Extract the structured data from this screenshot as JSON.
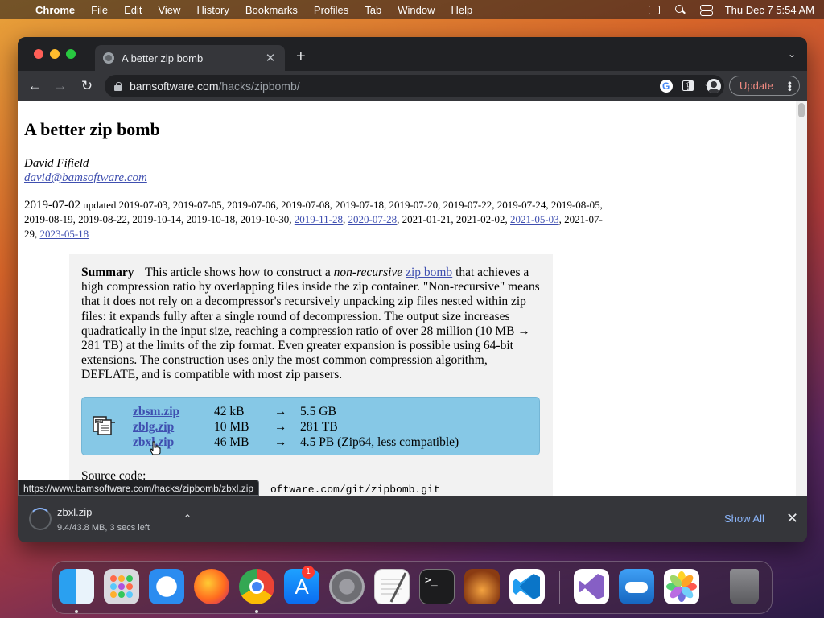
{
  "menubar": {
    "app_name": "Chrome",
    "items": [
      "File",
      "Edit",
      "View",
      "History",
      "Bookmarks",
      "Profiles",
      "Tab",
      "Window",
      "Help"
    ],
    "clock": "Thu Dec 7  5:54 AM"
  },
  "browser": {
    "tab_title": "A better zip bomb",
    "url_host": "bamsoftware.com",
    "url_path": "/hacks/zipbomb/",
    "update_label": "Update"
  },
  "page": {
    "title": "A better zip bomb",
    "author": "David Fifield",
    "email": "david@bamsoftware.com",
    "date_first": "2019-07-02",
    "date_updated_prefix": "updated 2019-07-03, 2019-07-05, 2019-07-06, 2019-07-08, 2019-07-18, 2019-07-20, 2019-07-22, 2019-07-24, 2019-08-05, 2019-08-19, 2019-08-22, 2019-10-14, 2019-10-18, 2019-10-30,",
    "date_links": [
      "2019-11-28",
      "2020-07-28"
    ],
    "date_mid": "2021-01-21, 2021-02-02,",
    "date_link3": "2021-05-03",
    "date_plain4": "2021-07-29,",
    "date_link4": "2023-05-18",
    "summary_label": "Summary",
    "summary_pre": "This article shows how to construct a",
    "summary_em": "non-recursive",
    "summary_link": "zip bomb",
    "summary_post": "that achieves a high compression ratio by overlapping files inside the zip container. \"Non-recursive\" means that it does not rely on a decompressor's recursively unpacking zip files nested within zip files: it expands fully after a single round of decompression. The output size increases quadratically in the input size, reaching a compression ratio of over 28 million (10 MB → 281 TB) at the limits of the zip format. Even greater expansion is possible using 64-bit extensions. The construction uses only the most common compression algorithm, DEFLATE, and is compatible with most zip parsers.",
    "downloads": [
      {
        "name": "zbsm.zip",
        "size": "42 kB",
        "arrow": "→",
        "result": "5.5 GB"
      },
      {
        "name": "zblg.zip",
        "size": "10 MB",
        "arrow": "→",
        "result": "281 TB"
      },
      {
        "name": "zbxl.zip",
        "size": "46 MB",
        "arrow": "→",
        "result": "4.5 PB (Zip64, less compatible)"
      }
    ],
    "source_label": "Source code:",
    "git_partial": "oftware.com/git/zipbomb.git",
    "status_url": "https://www.bamsoftware.com/hacks/zipbomb/zbxl.zip"
  },
  "download_bar": {
    "file_name": "zbxl.zip",
    "status": "9.4/43.8 MB, 3 secs left",
    "show_all": "Show All"
  },
  "dock": {
    "badge_count": "1",
    "apps": [
      "finder",
      "launchpad",
      "safari",
      "firefox",
      "chrome",
      "app-store",
      "system-settings",
      "textedit",
      "terminal",
      "garageband",
      "vscode",
      "visual-studio",
      "onedrive",
      "photos",
      "trash"
    ]
  }
}
